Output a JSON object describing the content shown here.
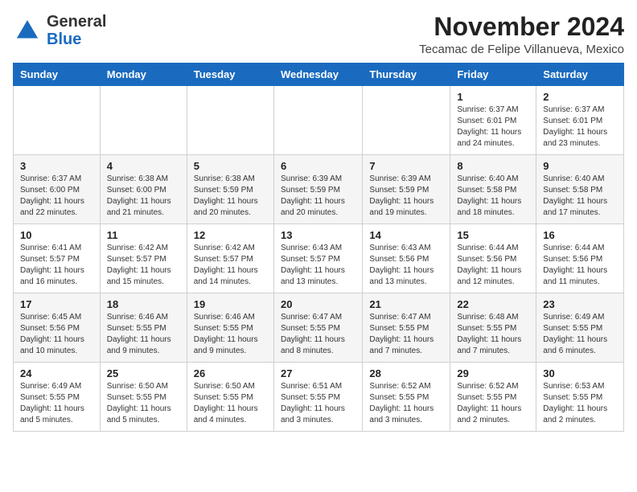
{
  "header": {
    "logo": {
      "general": "General",
      "blue": "Blue"
    },
    "month": "November 2024",
    "location": "Tecamac de Felipe Villanueva, Mexico"
  },
  "days_of_week": [
    "Sunday",
    "Monday",
    "Tuesday",
    "Wednesday",
    "Thursday",
    "Friday",
    "Saturday"
  ],
  "weeks": [
    [
      {
        "day": "",
        "info": ""
      },
      {
        "day": "",
        "info": ""
      },
      {
        "day": "",
        "info": ""
      },
      {
        "day": "",
        "info": ""
      },
      {
        "day": "",
        "info": ""
      },
      {
        "day": "1",
        "info": "Sunrise: 6:37 AM\nSunset: 6:01 PM\nDaylight: 11 hours and 24 minutes."
      },
      {
        "day": "2",
        "info": "Sunrise: 6:37 AM\nSunset: 6:01 PM\nDaylight: 11 hours and 23 minutes."
      }
    ],
    [
      {
        "day": "3",
        "info": "Sunrise: 6:37 AM\nSunset: 6:00 PM\nDaylight: 11 hours and 22 minutes."
      },
      {
        "day": "4",
        "info": "Sunrise: 6:38 AM\nSunset: 6:00 PM\nDaylight: 11 hours and 21 minutes."
      },
      {
        "day": "5",
        "info": "Sunrise: 6:38 AM\nSunset: 5:59 PM\nDaylight: 11 hours and 20 minutes."
      },
      {
        "day": "6",
        "info": "Sunrise: 6:39 AM\nSunset: 5:59 PM\nDaylight: 11 hours and 20 minutes."
      },
      {
        "day": "7",
        "info": "Sunrise: 6:39 AM\nSunset: 5:59 PM\nDaylight: 11 hours and 19 minutes."
      },
      {
        "day": "8",
        "info": "Sunrise: 6:40 AM\nSunset: 5:58 PM\nDaylight: 11 hours and 18 minutes."
      },
      {
        "day": "9",
        "info": "Sunrise: 6:40 AM\nSunset: 5:58 PM\nDaylight: 11 hours and 17 minutes."
      }
    ],
    [
      {
        "day": "10",
        "info": "Sunrise: 6:41 AM\nSunset: 5:57 PM\nDaylight: 11 hours and 16 minutes."
      },
      {
        "day": "11",
        "info": "Sunrise: 6:42 AM\nSunset: 5:57 PM\nDaylight: 11 hours and 15 minutes."
      },
      {
        "day": "12",
        "info": "Sunrise: 6:42 AM\nSunset: 5:57 PM\nDaylight: 11 hours and 14 minutes."
      },
      {
        "day": "13",
        "info": "Sunrise: 6:43 AM\nSunset: 5:57 PM\nDaylight: 11 hours and 13 minutes."
      },
      {
        "day": "14",
        "info": "Sunrise: 6:43 AM\nSunset: 5:56 PM\nDaylight: 11 hours and 13 minutes."
      },
      {
        "day": "15",
        "info": "Sunrise: 6:44 AM\nSunset: 5:56 PM\nDaylight: 11 hours and 12 minutes."
      },
      {
        "day": "16",
        "info": "Sunrise: 6:44 AM\nSunset: 5:56 PM\nDaylight: 11 hours and 11 minutes."
      }
    ],
    [
      {
        "day": "17",
        "info": "Sunrise: 6:45 AM\nSunset: 5:56 PM\nDaylight: 11 hours and 10 minutes."
      },
      {
        "day": "18",
        "info": "Sunrise: 6:46 AM\nSunset: 5:55 PM\nDaylight: 11 hours and 9 minutes."
      },
      {
        "day": "19",
        "info": "Sunrise: 6:46 AM\nSunset: 5:55 PM\nDaylight: 11 hours and 9 minutes."
      },
      {
        "day": "20",
        "info": "Sunrise: 6:47 AM\nSunset: 5:55 PM\nDaylight: 11 hours and 8 minutes."
      },
      {
        "day": "21",
        "info": "Sunrise: 6:47 AM\nSunset: 5:55 PM\nDaylight: 11 hours and 7 minutes."
      },
      {
        "day": "22",
        "info": "Sunrise: 6:48 AM\nSunset: 5:55 PM\nDaylight: 11 hours and 7 minutes."
      },
      {
        "day": "23",
        "info": "Sunrise: 6:49 AM\nSunset: 5:55 PM\nDaylight: 11 hours and 6 minutes."
      }
    ],
    [
      {
        "day": "24",
        "info": "Sunrise: 6:49 AM\nSunset: 5:55 PM\nDaylight: 11 hours and 5 minutes."
      },
      {
        "day": "25",
        "info": "Sunrise: 6:50 AM\nSunset: 5:55 PM\nDaylight: 11 hours and 5 minutes."
      },
      {
        "day": "26",
        "info": "Sunrise: 6:50 AM\nSunset: 5:55 PM\nDaylight: 11 hours and 4 minutes."
      },
      {
        "day": "27",
        "info": "Sunrise: 6:51 AM\nSunset: 5:55 PM\nDaylight: 11 hours and 3 minutes."
      },
      {
        "day": "28",
        "info": "Sunrise: 6:52 AM\nSunset: 5:55 PM\nDaylight: 11 hours and 3 minutes."
      },
      {
        "day": "29",
        "info": "Sunrise: 6:52 AM\nSunset: 5:55 PM\nDaylight: 11 hours and 2 minutes."
      },
      {
        "day": "30",
        "info": "Sunrise: 6:53 AM\nSunset: 5:55 PM\nDaylight: 11 hours and 2 minutes."
      }
    ]
  ]
}
